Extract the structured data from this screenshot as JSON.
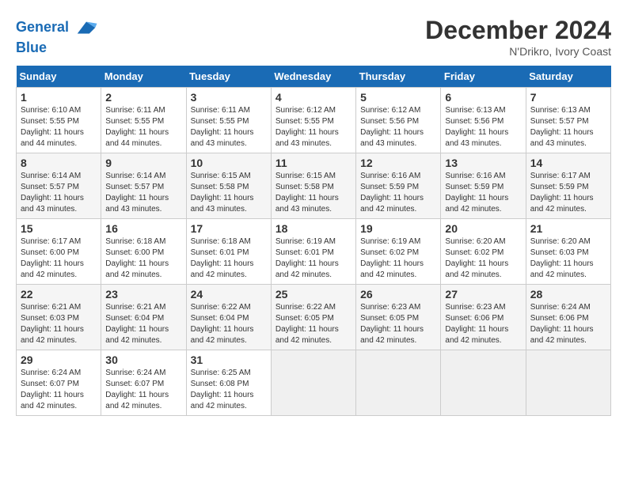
{
  "header": {
    "logo_line1": "General",
    "logo_line2": "Blue",
    "month_year": "December 2024",
    "location": "N'Drikro, Ivory Coast"
  },
  "days_of_week": [
    "Sunday",
    "Monday",
    "Tuesday",
    "Wednesday",
    "Thursday",
    "Friday",
    "Saturday"
  ],
  "weeks": [
    [
      {
        "day": 1,
        "rise": "6:10 AM",
        "set": "5:55 PM",
        "daylight": "11 hours and 44 minutes"
      },
      {
        "day": 2,
        "rise": "6:11 AM",
        "set": "5:55 PM",
        "daylight": "11 hours and 44 minutes"
      },
      {
        "day": 3,
        "rise": "6:11 AM",
        "set": "5:55 PM",
        "daylight": "11 hours and 43 minutes"
      },
      {
        "day": 4,
        "rise": "6:12 AM",
        "set": "5:55 PM",
        "daylight": "11 hours and 43 minutes"
      },
      {
        "day": 5,
        "rise": "6:12 AM",
        "set": "5:56 PM",
        "daylight": "11 hours and 43 minutes"
      },
      {
        "day": 6,
        "rise": "6:13 AM",
        "set": "5:56 PM",
        "daylight": "11 hours and 43 minutes"
      },
      {
        "day": 7,
        "rise": "6:13 AM",
        "set": "5:57 PM",
        "daylight": "11 hours and 43 minutes"
      }
    ],
    [
      {
        "day": 8,
        "rise": "6:14 AM",
        "set": "5:57 PM",
        "daylight": "11 hours and 43 minutes"
      },
      {
        "day": 9,
        "rise": "6:14 AM",
        "set": "5:57 PM",
        "daylight": "11 hours and 43 minutes"
      },
      {
        "day": 10,
        "rise": "6:15 AM",
        "set": "5:58 PM",
        "daylight": "11 hours and 43 minutes"
      },
      {
        "day": 11,
        "rise": "6:15 AM",
        "set": "5:58 PM",
        "daylight": "11 hours and 43 minutes"
      },
      {
        "day": 12,
        "rise": "6:16 AM",
        "set": "5:59 PM",
        "daylight": "11 hours and 42 minutes"
      },
      {
        "day": 13,
        "rise": "6:16 AM",
        "set": "5:59 PM",
        "daylight": "11 hours and 42 minutes"
      },
      {
        "day": 14,
        "rise": "6:17 AM",
        "set": "5:59 PM",
        "daylight": "11 hours and 42 minutes"
      }
    ],
    [
      {
        "day": 15,
        "rise": "6:17 AM",
        "set": "6:00 PM",
        "daylight": "11 hours and 42 minutes"
      },
      {
        "day": 16,
        "rise": "6:18 AM",
        "set": "6:00 PM",
        "daylight": "11 hours and 42 minutes"
      },
      {
        "day": 17,
        "rise": "6:18 AM",
        "set": "6:01 PM",
        "daylight": "11 hours and 42 minutes"
      },
      {
        "day": 18,
        "rise": "6:19 AM",
        "set": "6:01 PM",
        "daylight": "11 hours and 42 minutes"
      },
      {
        "day": 19,
        "rise": "6:19 AM",
        "set": "6:02 PM",
        "daylight": "11 hours and 42 minutes"
      },
      {
        "day": 20,
        "rise": "6:20 AM",
        "set": "6:02 PM",
        "daylight": "11 hours and 42 minutes"
      },
      {
        "day": 21,
        "rise": "6:20 AM",
        "set": "6:03 PM",
        "daylight": "11 hours and 42 minutes"
      }
    ],
    [
      {
        "day": 22,
        "rise": "6:21 AM",
        "set": "6:03 PM",
        "daylight": "11 hours and 42 minutes"
      },
      {
        "day": 23,
        "rise": "6:21 AM",
        "set": "6:04 PM",
        "daylight": "11 hours and 42 minutes"
      },
      {
        "day": 24,
        "rise": "6:22 AM",
        "set": "6:04 PM",
        "daylight": "11 hours and 42 minutes"
      },
      {
        "day": 25,
        "rise": "6:22 AM",
        "set": "6:05 PM",
        "daylight": "11 hours and 42 minutes"
      },
      {
        "day": 26,
        "rise": "6:23 AM",
        "set": "6:05 PM",
        "daylight": "11 hours and 42 minutes"
      },
      {
        "day": 27,
        "rise": "6:23 AM",
        "set": "6:06 PM",
        "daylight": "11 hours and 42 minutes"
      },
      {
        "day": 28,
        "rise": "6:24 AM",
        "set": "6:06 PM",
        "daylight": "11 hours and 42 minutes"
      }
    ],
    [
      {
        "day": 29,
        "rise": "6:24 AM",
        "set": "6:07 PM",
        "daylight": "11 hours and 42 minutes"
      },
      {
        "day": 30,
        "rise": "6:24 AM",
        "set": "6:07 PM",
        "daylight": "11 hours and 42 minutes"
      },
      {
        "day": 31,
        "rise": "6:25 AM",
        "set": "6:08 PM",
        "daylight": "11 hours and 42 minutes"
      },
      null,
      null,
      null,
      null
    ]
  ]
}
